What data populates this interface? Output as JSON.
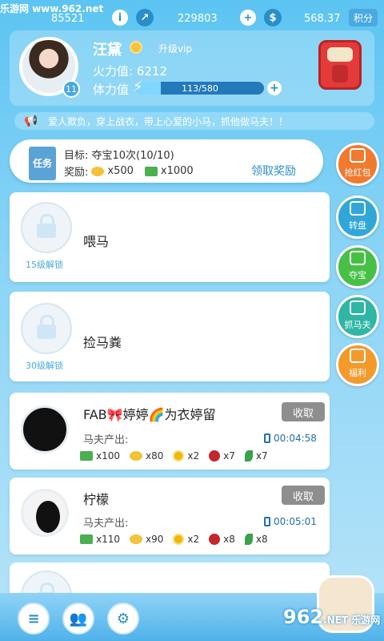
{
  "watermark": "乐游网 www.962.net",
  "topbar": {
    "id_text": "85521",
    "currency1": "229803",
    "currency2": "568.37",
    "points_btn": "积分",
    "info_icon": "i"
  },
  "profile": {
    "name": "汪黛",
    "level": "11",
    "vip_btn": "升级vip",
    "firepower_label": "火力值:",
    "firepower_value": "6212",
    "stamina_label": "体力值",
    "stamina_text": "113/580",
    "stamina_fraction": 0.195
  },
  "notice": "爱人欺负，穿上战衣，带上心爱的小马，抓他做马夫！！",
  "task": {
    "flag": "任务",
    "target": "目标: 夺宝10次(10/10)",
    "reward_label": "奖励:",
    "reward_gold": "x500",
    "reward_cash": "x1000",
    "claim_btn": "领取奖励"
  },
  "cards": [
    {
      "title": "喂马",
      "lock": "15级解锁"
    },
    {
      "title": "捡马粪",
      "lock": "30级解锁"
    },
    {
      "title": "FAB🎀婷婷🌈为衣婷留",
      "btn": "收取",
      "output_label": "马夫产出:",
      "timer": "00:04:58",
      "items": [
        "x100",
        "x80",
        "x2",
        "x7",
        "x7"
      ]
    },
    {
      "title": "柠檬",
      "btn": "收取",
      "output_label": "马夫产出:",
      "timer": "00:05:01",
      "items": [
        "x110",
        "x90",
        "x2",
        "x8",
        "x8"
      ]
    }
  ],
  "side_menu": [
    {
      "label": "抢红包",
      "color": "#f07a2f",
      "icon": "red-envelope-icon"
    },
    {
      "label": "转盘",
      "color": "#31a7d9",
      "icon": "wheel-icon"
    },
    {
      "label": "夺宝",
      "color": "#47c145",
      "icon": "treasure-icon"
    },
    {
      "label": "抓马夫",
      "color": "#2fb6a5",
      "icon": "catch-icon"
    },
    {
      "label": "福利",
      "color": "#f39a2b",
      "icon": "gift-icon"
    }
  ],
  "bottom_nav": [
    {
      "icon": "chat-icon"
    },
    {
      "icon": "friends-icon"
    },
    {
      "icon": "settings-icon"
    }
  ],
  "logo_text": "962",
  "logo_sub": ".NET 乐游网"
}
